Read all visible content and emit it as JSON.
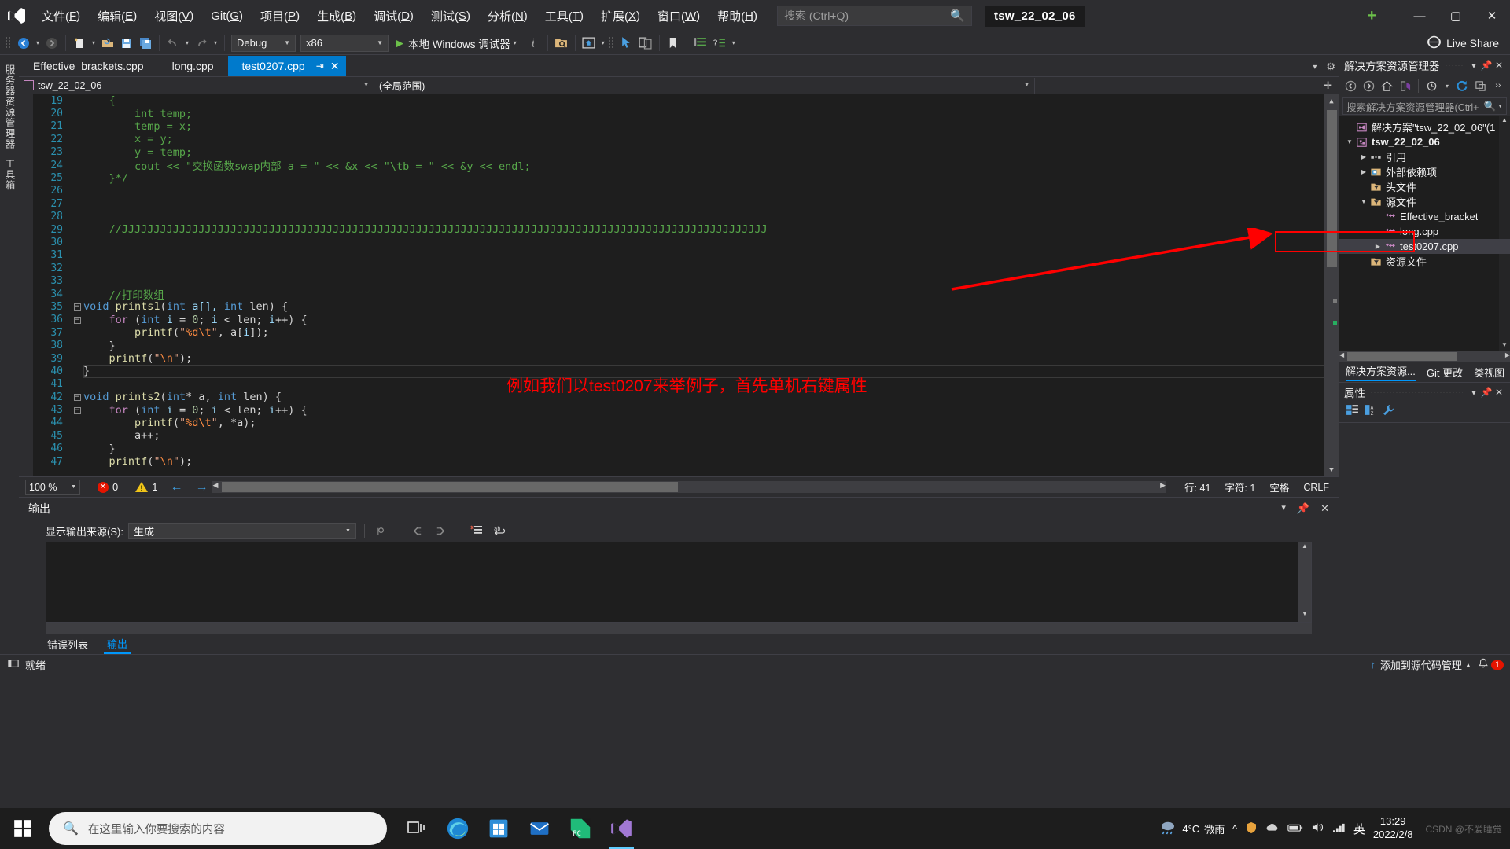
{
  "app": {
    "title": "tsw_22_02_06",
    "logo_icon": "visual-studio-icon"
  },
  "menu": {
    "items": [
      {
        "label": "文件(F)"
      },
      {
        "label": "编辑(E)"
      },
      {
        "label": "视图(V)"
      },
      {
        "label": "Git(G)"
      },
      {
        "label": "项目(P)"
      },
      {
        "label": "生成(B)"
      },
      {
        "label": "调试(D)"
      },
      {
        "label": "测试(S)"
      },
      {
        "label": "分析(N)"
      },
      {
        "label": "工具(T)"
      },
      {
        "label": "扩展(X)"
      },
      {
        "label": "窗口(W)"
      },
      {
        "label": "帮助(H)"
      }
    ],
    "search_placeholder": "搜索 (Ctrl+Q)",
    "search_icon": "magnifier-icon"
  },
  "window_controls": {
    "minimize": "—",
    "maximize": "▢",
    "close": "✕",
    "account_icon": "add-account-icon"
  },
  "toolbar": {
    "nav_back": "◀",
    "nav_forward": "▶",
    "new_project_icon": "new-project-icon",
    "open_icon": "open-folder-icon",
    "save_icon": "save-icon",
    "save_all_icon": "save-all-icon",
    "undo_icon": "undo-icon",
    "redo_icon": "redo-icon",
    "config_combo": "Debug",
    "platform_combo": "x86",
    "run_label": "本地 Windows 调试器",
    "live_share_label": "Live Share",
    "live_share_icon": "live-share-icon"
  },
  "tabs": {
    "items": [
      {
        "label": "Effective_brackets.cpp",
        "active": false
      },
      {
        "label": "long.cpp",
        "active": false
      },
      {
        "label": "test0207.cpp",
        "active": true,
        "pin": "⇥",
        "close": "✕"
      }
    ]
  },
  "navbar": {
    "project_scope": "tsw_22_02_06",
    "member_scope": "(全局范围)",
    "caret": "▾"
  },
  "editor": {
    "lines": [
      {
        "n": 19,
        "fold": "",
        "tokens": [
          {
            "t": "    ",
            "c": "cm"
          },
          {
            "t": "{",
            "c": "cm"
          }
        ]
      },
      {
        "n": 20,
        "fold": "",
        "tokens": [
          {
            "t": "        int temp;",
            "c": "cm"
          }
        ]
      },
      {
        "n": 21,
        "fold": "",
        "tokens": [
          {
            "t": "        temp = x;",
            "c": "cm"
          }
        ]
      },
      {
        "n": 22,
        "fold": "",
        "tokens": [
          {
            "t": "        x = y;",
            "c": "cm"
          }
        ]
      },
      {
        "n": 23,
        "fold": "",
        "tokens": [
          {
            "t": "        y = temp;",
            "c": "cm"
          }
        ]
      },
      {
        "n": 24,
        "fold": "",
        "tokens": [
          {
            "t": "        cout << \"交换函数swap内部 a = \" << &x << \"\\tb = \" << &y << endl;",
            "c": "cm"
          }
        ]
      },
      {
        "n": 25,
        "fold": "",
        "tokens": [
          {
            "t": "    }*/",
            "c": "cm"
          }
        ]
      },
      {
        "n": 26,
        "fold": "",
        "tokens": []
      },
      {
        "n": 27,
        "fold": "",
        "tokens": []
      },
      {
        "n": 28,
        "fold": "",
        "tokens": []
      },
      {
        "n": 29,
        "fold": "",
        "tokens": [
          {
            "t": "    //ЈЈЈЈЈЈЈЈЈЈЈЈЈЈЈЈЈЈЈЈЈЈЈЈЈЈЈЈЈЈЈЈЈЈЈЈЈЈЈЈЈЈЈЈЈЈЈЈЈЈЈЈЈЈЈЈЈЈЈЈЈЈЈЈЈЈЈЈЈЈЈЈЈЈЈЈЈЈЈЈЈЈЈЈЈЈЈЈЈЈЈЈЈЈЈЈЈЈЈЈЈ",
            "c": "cm"
          }
        ]
      },
      {
        "n": 30,
        "fold": "",
        "tokens": []
      },
      {
        "n": 31,
        "fold": "",
        "tokens": []
      },
      {
        "n": 32,
        "fold": "",
        "tokens": []
      },
      {
        "n": 33,
        "fold": "",
        "tokens": []
      },
      {
        "n": 34,
        "fold": "",
        "tokens": [
          {
            "t": "    //打印数组",
            "c": "cm"
          }
        ]
      },
      {
        "n": 35,
        "fold": "-",
        "tokens": [
          {
            "t": "void ",
            "c": "kw"
          },
          {
            "t": "prints1",
            "c": "fn"
          },
          {
            "t": "(",
            "c": "pun"
          },
          {
            "t": "int",
            "c": "kw"
          },
          {
            "t": " a[], ",
            "c": "var"
          },
          {
            "t": "int",
            "c": "kw"
          },
          {
            "t": " len) {",
            "c": "ctxt"
          }
        ]
      },
      {
        "n": 36,
        "fold": "-",
        "tokens": [
          {
            "t": "    ",
            "c": "ctxt"
          },
          {
            "t": "for",
            "c": "kw2"
          },
          {
            "t": " (",
            "c": "pun"
          },
          {
            "t": "int",
            "c": "kw"
          },
          {
            "t": " ",
            "c": "ctxt"
          },
          {
            "t": "i",
            "c": "var"
          },
          {
            "t": " = ",
            "c": "ctxt"
          },
          {
            "t": "0",
            "c": "num"
          },
          {
            "t": "; ",
            "c": "ctxt"
          },
          {
            "t": "i",
            "c": "var"
          },
          {
            "t": " < len; ",
            "c": "ctxt"
          },
          {
            "t": "i",
            "c": "var"
          },
          {
            "t": "++) {",
            "c": "ctxt"
          }
        ]
      },
      {
        "n": 37,
        "fold": "",
        "tokens": [
          {
            "t": "        ",
            "c": "ctxt"
          },
          {
            "t": "printf",
            "c": "fn"
          },
          {
            "t": "(",
            "c": "pun"
          },
          {
            "t": "\"",
            "c": "str"
          },
          {
            "t": "%d",
            "c": "esc"
          },
          {
            "t": "\\t",
            "c": "esc"
          },
          {
            "t": "\"",
            "c": "str"
          },
          {
            "t": ", a[",
            "c": "ctxt"
          },
          {
            "t": "i",
            "c": "var"
          },
          {
            "t": "]);",
            "c": "ctxt"
          }
        ]
      },
      {
        "n": 38,
        "fold": "",
        "tokens": [
          {
            "t": "    }",
            "c": "ctxt"
          }
        ]
      },
      {
        "n": 39,
        "fold": "",
        "tokens": [
          {
            "t": "    ",
            "c": "ctxt"
          },
          {
            "t": "printf",
            "c": "fn"
          },
          {
            "t": "(",
            "c": "pun"
          },
          {
            "t": "\"",
            "c": "str"
          },
          {
            "t": "\\n",
            "c": "esc"
          },
          {
            "t": "\"",
            "c": "str"
          },
          {
            "t": ");",
            "c": "ctxt"
          }
        ]
      },
      {
        "n": 40,
        "fold": "",
        "tokens": [
          {
            "t": "}",
            "c": "ctxt"
          }
        ]
      },
      {
        "n": 41,
        "fold": "",
        "tokens": []
      },
      {
        "n": 42,
        "fold": "-",
        "tokens": [
          {
            "t": "void ",
            "c": "kw"
          },
          {
            "t": "prints2",
            "c": "fn"
          },
          {
            "t": "(",
            "c": "pun"
          },
          {
            "t": "int",
            "c": "kw"
          },
          {
            "t": "* a, ",
            "c": "ctxt"
          },
          {
            "t": "int",
            "c": "kw"
          },
          {
            "t": " len) {",
            "c": "ctxt"
          }
        ]
      },
      {
        "n": 43,
        "fold": "-",
        "tokens": [
          {
            "t": "    ",
            "c": "ctxt"
          },
          {
            "t": "for",
            "c": "kw2"
          },
          {
            "t": " (",
            "c": "pun"
          },
          {
            "t": "int",
            "c": "kw"
          },
          {
            "t": " ",
            "c": "ctxt"
          },
          {
            "t": "i",
            "c": "var"
          },
          {
            "t": " = ",
            "c": "ctxt"
          },
          {
            "t": "0",
            "c": "num"
          },
          {
            "t": "; ",
            "c": "ctxt"
          },
          {
            "t": "i",
            "c": "var"
          },
          {
            "t": " < len; ",
            "c": "ctxt"
          },
          {
            "t": "i",
            "c": "var"
          },
          {
            "t": "++) {",
            "c": "ctxt"
          }
        ]
      },
      {
        "n": 44,
        "fold": "",
        "tokens": [
          {
            "t": "        ",
            "c": "ctxt"
          },
          {
            "t": "printf",
            "c": "fn"
          },
          {
            "t": "(",
            "c": "pun"
          },
          {
            "t": "\"",
            "c": "str"
          },
          {
            "t": "%d",
            "c": "esc"
          },
          {
            "t": "\\t",
            "c": "esc"
          },
          {
            "t": "\"",
            "c": "str"
          },
          {
            "t": ", *a);",
            "c": "ctxt"
          }
        ]
      },
      {
        "n": 45,
        "fold": "",
        "tokens": [
          {
            "t": "        a++;",
            "c": "ctxt"
          }
        ]
      },
      {
        "n": 46,
        "fold": "",
        "tokens": [
          {
            "t": "    }",
            "c": "ctxt"
          }
        ]
      },
      {
        "n": 47,
        "fold": "",
        "tokens": [
          {
            "t": "    ",
            "c": "ctxt"
          },
          {
            "t": "printf",
            "c": "fn"
          },
          {
            "t": "(",
            "c": "pun"
          },
          {
            "t": "\"",
            "c": "str"
          },
          {
            "t": "\\n",
            "c": "esc"
          },
          {
            "t": "\"",
            "c": "str"
          },
          {
            "t": ");",
            "c": "ctxt"
          }
        ]
      }
    ],
    "current_line_index": 21
  },
  "editor_status": {
    "zoom": "100 %",
    "zoom_caret": "▾",
    "error_count": "0",
    "warning_count": "1",
    "prev_icon": "arrow-left-icon",
    "next_icon": "arrow-right-icon",
    "line": "行: 41",
    "col": "字符: 1",
    "spaces": "空格",
    "eol": "CRLF"
  },
  "output_panel": {
    "title": "输出",
    "source_label": "显示输出来源(S):",
    "source_value": "生成",
    "source_caret": "▾",
    "minimize_icon": "chevron-down-icon",
    "pin_icon": "pin-icon",
    "close_icon": "close-icon",
    "tabs": [
      {
        "label": "错误列表",
        "selected": false
      },
      {
        "label": "输出",
        "selected": true
      }
    ]
  },
  "left_rail": {
    "items": [
      {
        "label": "服务器资源管理器"
      },
      {
        "label": "工具箱"
      }
    ]
  },
  "solution_explorer": {
    "title": "解决方案资源管理器",
    "search_placeholder": "搜索解决方案资源管理器(Ctrl+",
    "search_icon": "magnifier-icon",
    "toolbar_icons": [
      "back-icon",
      "forward-icon",
      "home-icon",
      "sync-with-active-doc-icon",
      "pending-changes-icon",
      "refresh-icon",
      "show-all-files-icon"
    ],
    "tree": [
      {
        "depth": 0,
        "arrow": "",
        "icon": "solution-icon",
        "label": "解决方案\"tsw_22_02_06\"(1",
        "bold": false,
        "selected": false
      },
      {
        "depth": 0,
        "arrow": "▼",
        "icon": "project-icon",
        "label": "tsw_22_02_06",
        "bold": true,
        "selected": false
      },
      {
        "depth": 1,
        "arrow": "▶",
        "icon": "references-icon",
        "label": "引用",
        "bold": false,
        "selected": false
      },
      {
        "depth": 1,
        "arrow": "▶",
        "icon": "external-deps-icon",
        "label": "外部依赖项",
        "bold": false,
        "selected": false
      },
      {
        "depth": 1,
        "arrow": "",
        "icon": "filter-folder-icon",
        "label": "头文件",
        "bold": false,
        "selected": false
      },
      {
        "depth": 1,
        "arrow": "▼",
        "icon": "filter-folder-icon",
        "label": "源文件",
        "bold": false,
        "selected": false
      },
      {
        "depth": 2,
        "arrow": "",
        "icon": "cpp-file-icon",
        "label": "Effective_bracket",
        "bold": false,
        "selected": false
      },
      {
        "depth": 2,
        "arrow": "",
        "icon": "cpp-file-icon",
        "label": "long.cpp",
        "bold": false,
        "selected": false
      },
      {
        "depth": 2,
        "arrow": "▶",
        "icon": "cpp-file-icon",
        "label": "test0207.cpp",
        "bold": false,
        "selected": true
      },
      {
        "depth": 1,
        "arrow": "",
        "icon": "filter-folder-icon",
        "label": "资源文件",
        "bold": false,
        "selected": false
      }
    ],
    "bottom_tabs": [
      {
        "label": "解决方案资源...",
        "selected": true
      },
      {
        "label": "Git 更改",
        "selected": false
      },
      {
        "label": "类视图",
        "selected": false
      }
    ]
  },
  "properties_panel": {
    "title": "属性",
    "minimize_icon": "chevron-down-icon",
    "pin_icon": "pin-icon",
    "close_icon": "close-icon",
    "toolbar_icons": [
      "categorized-icon",
      "alphabetical-icon",
      "properties-icon"
    ]
  },
  "annotation": {
    "text": "例如我们以test0207来举例子，首先单机右键属性",
    "color": "#ff0000",
    "arrow": "red-arrow-pointing-to-test0207"
  },
  "vs_status_bar": {
    "ready_label": "就绪",
    "ready_icon": "ready-icon",
    "source_control_label": "添加到源代码管理",
    "source_control_caret": "▴",
    "notification_count": "1",
    "bell_icon": "bell-icon",
    "up_arrow_icon": "up-arrow-icon"
  },
  "taskbar": {
    "start_icon": "windows-start-icon",
    "search_placeholder": "在这里输入你要搜索的内容",
    "search_icon": "magnifier-icon",
    "task_view_icon": "task-view-icon",
    "apps": [
      {
        "name": "edge-icon",
        "active": false
      },
      {
        "name": "microsoft-store-icon",
        "active": false
      },
      {
        "name": "mail-icon",
        "active": false
      },
      {
        "name": "pycharm-icon",
        "active": false
      },
      {
        "name": "visual-studio-icon",
        "active": true
      }
    ],
    "weather_temp": "4°C",
    "weather_desc": "微雨",
    "weather_icon": "rain-cloud-icon",
    "tray_icons": [
      "chevron-up-icon",
      "security-icon",
      "onedrive-icon",
      "battery-icon",
      "volume-icon",
      "network-icon"
    ],
    "ime_label": "英",
    "time": "13:29",
    "date": "2022/2/8",
    "watermark": "CSDN @不爱睡觉"
  }
}
